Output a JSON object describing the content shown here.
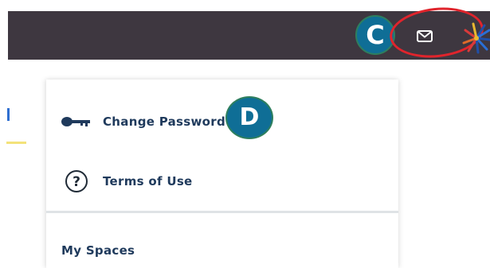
{
  "callouts": {
    "c": "C",
    "d": "D"
  },
  "header": {
    "mail_icon": "mail-icon",
    "logo_icon": "star-logo-icon"
  },
  "menu": {
    "items": [
      {
        "label": "Change Password",
        "icon": "key-icon"
      },
      {
        "label": "Terms of Use",
        "icon": "help-circle-icon"
      }
    ],
    "section_title": "My Spaces"
  },
  "colors": {
    "topbar": "#3e3740",
    "callout": "#0f6e96",
    "highlight_ring": "#e0242c",
    "menu_text": "#1f3a5c"
  }
}
